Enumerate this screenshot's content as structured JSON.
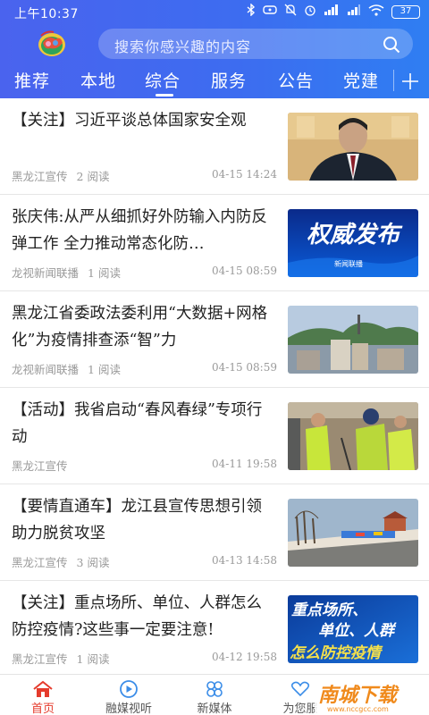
{
  "status_bar": {
    "time": "上午10:37",
    "battery": "37"
  },
  "search": {
    "placeholder": "搜索你感兴趣的内容"
  },
  "tabs": [
    {
      "label": "推荐",
      "active": false
    },
    {
      "label": "本地",
      "active": false
    },
    {
      "label": "综合",
      "active": true
    },
    {
      "label": "服务",
      "active": false
    },
    {
      "label": "公告",
      "active": false
    },
    {
      "label": "党建",
      "active": false
    }
  ],
  "feed": [
    {
      "title": "【关注】习近平谈总体国家安全观",
      "source": "黑龙江宣传",
      "reads": "2 阅读",
      "time": "04-15 14:24",
      "thumb": "portrait-photo"
    },
    {
      "title": "张庆伟:从严从细抓好外防输入内防反弹工作 全力推动常态化防…",
      "source": "龙视新闻联播",
      "reads": "1 阅读",
      "time": "04-15 08:59",
      "thumb": "权威发布",
      "thumb_caption": "新闻联播"
    },
    {
      "title": "黑龙江省委政法委利用“大数据+网格化”为疫情排查添“智”力",
      "source": "龙视新闻联播",
      "reads": "1 阅读",
      "time": "04-15 08:59",
      "thumb": "city-photo"
    },
    {
      "title": "【活动】我省启动“春风春绿”专项行动",
      "source": "黑龙江宣传",
      "reads": "",
      "time": "04-11 19:58",
      "thumb": "volunteers-photo"
    },
    {
      "title": "【要情直通车】龙江县宣传思想引领 助力脱贫攻坚",
      "source": "黑龙江宣传",
      "reads": "3 阅读",
      "time": "04-13 14:58",
      "thumb": "village-photo"
    },
    {
      "title": "【关注】重点场所、单位、人群怎么防控疫情?这些事一定要注意!",
      "source": "黑龙江宣传",
      "reads": "1 阅读",
      "time": "04-12 19:58",
      "thumb": "重点场所、单位、人群 怎么防控疫情"
    }
  ],
  "thumb_text": {
    "item2_big": "权威发布",
    "item2_small": "新闻联播",
    "item6_line1": "重点场所、",
    "item6_line2": "单位、人群",
    "item6_line3": "怎么防控疫情"
  },
  "bottom_nav": [
    {
      "label": "首页",
      "icon": "home-icon",
      "active": true
    },
    {
      "label": "融媒视听",
      "icon": "play-circle-icon",
      "active": false
    },
    {
      "label": "新媒体",
      "icon": "grid-flower-icon",
      "active": false
    },
    {
      "label": "为您服",
      "icon": "heart-hand-icon",
      "active": false
    }
  ],
  "watermark": {
    "text": "南城下载",
    "url_text": "www.nccgcc.com"
  },
  "colors": {
    "header_start": "#4a63ee",
    "header_end": "#2f7ef2",
    "active_nav": "#e53b2c"
  }
}
